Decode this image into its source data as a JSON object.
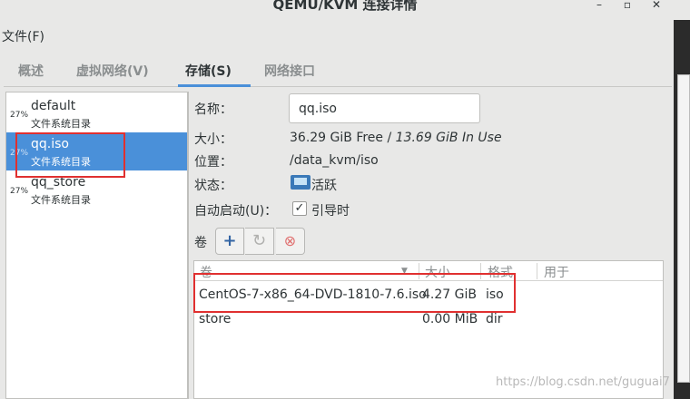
{
  "window": {
    "title": "QEMU/KVM 连接详情",
    "buttons": [
      "–",
      "▫",
      "✕"
    ]
  },
  "menu": {
    "file": "文件(F)"
  },
  "tabs": [
    {
      "label": "概述",
      "active": false
    },
    {
      "label": "虚拟网络(V)",
      "active": false
    },
    {
      "label": "存储(S)",
      "active": true
    },
    {
      "label": "网络接口",
      "active": false
    }
  ],
  "pools": [
    {
      "pct": "27%",
      "name": "default",
      "type": "文件系统目录",
      "selected": false
    },
    {
      "pct": "27%",
      "name": "qq.iso",
      "type": "文件系统目录",
      "selected": true
    },
    {
      "pct": "27%",
      "name": "qq_store",
      "type": "文件系统目录",
      "selected": false
    }
  ],
  "details": {
    "name_label": "名称：",
    "name_value": "qq.iso",
    "size_label": "大小：",
    "size_free": "36.29 GiB Free / ",
    "size_inuse": "13.69 GiB In Use",
    "location_label": "位置：",
    "location_value": "/data_kvm/iso",
    "state_label": "状态：",
    "state_value": "活跃",
    "autostart_label": "自动启动(U)：",
    "autostart_checked": true,
    "autostart_value": "引导时",
    "volumes_label": "卷"
  },
  "toolbar": {
    "add": "+",
    "refresh": "↻",
    "delete": "⊗"
  },
  "volumes": {
    "headers": [
      "卷",
      "大小",
      "格式",
      "用于"
    ],
    "rows": [
      {
        "name": "CentOS-7-x86_64-DVD-1810-7.6.iso",
        "size": "4.27 GiB",
        "format": "iso",
        "used_by": ""
      },
      {
        "name": "store",
        "size": "0.00 MiB",
        "format": "dir",
        "used_by": ""
      }
    ]
  },
  "watermark": "https://blog.csdn.net/guguai7",
  "colors": {
    "accent": "#4a90d9",
    "highlight_box": "#e03030",
    "window_bg": "#e8e8e7"
  }
}
